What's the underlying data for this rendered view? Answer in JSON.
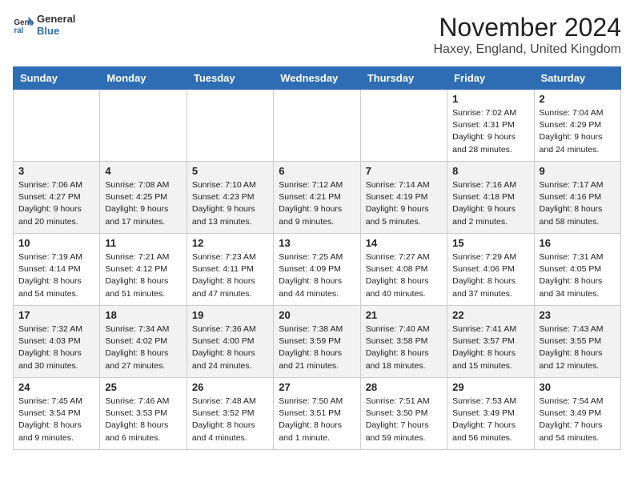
{
  "logo": {
    "general": "General",
    "blue": "Blue"
  },
  "title": "November 2024",
  "location": "Haxey, England, United Kingdom",
  "days_of_week": [
    "Sunday",
    "Monday",
    "Tuesday",
    "Wednesday",
    "Thursday",
    "Friday",
    "Saturday"
  ],
  "weeks": [
    [
      {
        "day": "",
        "info": ""
      },
      {
        "day": "",
        "info": ""
      },
      {
        "day": "",
        "info": ""
      },
      {
        "day": "",
        "info": ""
      },
      {
        "day": "",
        "info": ""
      },
      {
        "day": "1",
        "info": "Sunrise: 7:02 AM\nSunset: 4:31 PM\nDaylight: 9 hours and 28 minutes."
      },
      {
        "day": "2",
        "info": "Sunrise: 7:04 AM\nSunset: 4:29 PM\nDaylight: 9 hours and 24 minutes."
      }
    ],
    [
      {
        "day": "3",
        "info": "Sunrise: 7:06 AM\nSunset: 4:27 PM\nDaylight: 9 hours and 20 minutes."
      },
      {
        "day": "4",
        "info": "Sunrise: 7:08 AM\nSunset: 4:25 PM\nDaylight: 9 hours and 17 minutes."
      },
      {
        "day": "5",
        "info": "Sunrise: 7:10 AM\nSunset: 4:23 PM\nDaylight: 9 hours and 13 minutes."
      },
      {
        "day": "6",
        "info": "Sunrise: 7:12 AM\nSunset: 4:21 PM\nDaylight: 9 hours and 9 minutes."
      },
      {
        "day": "7",
        "info": "Sunrise: 7:14 AM\nSunset: 4:19 PM\nDaylight: 9 hours and 5 minutes."
      },
      {
        "day": "8",
        "info": "Sunrise: 7:16 AM\nSunset: 4:18 PM\nDaylight: 9 hours and 2 minutes."
      },
      {
        "day": "9",
        "info": "Sunrise: 7:17 AM\nSunset: 4:16 PM\nDaylight: 8 hours and 58 minutes."
      }
    ],
    [
      {
        "day": "10",
        "info": "Sunrise: 7:19 AM\nSunset: 4:14 PM\nDaylight: 8 hours and 54 minutes."
      },
      {
        "day": "11",
        "info": "Sunrise: 7:21 AM\nSunset: 4:12 PM\nDaylight: 8 hours and 51 minutes."
      },
      {
        "day": "12",
        "info": "Sunrise: 7:23 AM\nSunset: 4:11 PM\nDaylight: 8 hours and 47 minutes."
      },
      {
        "day": "13",
        "info": "Sunrise: 7:25 AM\nSunset: 4:09 PM\nDaylight: 8 hours and 44 minutes."
      },
      {
        "day": "14",
        "info": "Sunrise: 7:27 AM\nSunset: 4:08 PM\nDaylight: 8 hours and 40 minutes."
      },
      {
        "day": "15",
        "info": "Sunrise: 7:29 AM\nSunset: 4:06 PM\nDaylight: 8 hours and 37 minutes."
      },
      {
        "day": "16",
        "info": "Sunrise: 7:31 AM\nSunset: 4:05 PM\nDaylight: 8 hours and 34 minutes."
      }
    ],
    [
      {
        "day": "17",
        "info": "Sunrise: 7:32 AM\nSunset: 4:03 PM\nDaylight: 8 hours and 30 minutes."
      },
      {
        "day": "18",
        "info": "Sunrise: 7:34 AM\nSunset: 4:02 PM\nDaylight: 8 hours and 27 minutes."
      },
      {
        "day": "19",
        "info": "Sunrise: 7:36 AM\nSunset: 4:00 PM\nDaylight: 8 hours and 24 minutes."
      },
      {
        "day": "20",
        "info": "Sunrise: 7:38 AM\nSunset: 3:59 PM\nDaylight: 8 hours and 21 minutes."
      },
      {
        "day": "21",
        "info": "Sunrise: 7:40 AM\nSunset: 3:58 PM\nDaylight: 8 hours and 18 minutes."
      },
      {
        "day": "22",
        "info": "Sunrise: 7:41 AM\nSunset: 3:57 PM\nDaylight: 8 hours and 15 minutes."
      },
      {
        "day": "23",
        "info": "Sunrise: 7:43 AM\nSunset: 3:55 PM\nDaylight: 8 hours and 12 minutes."
      }
    ],
    [
      {
        "day": "24",
        "info": "Sunrise: 7:45 AM\nSunset: 3:54 PM\nDaylight: 8 hours and 9 minutes."
      },
      {
        "day": "25",
        "info": "Sunrise: 7:46 AM\nSunset: 3:53 PM\nDaylight: 8 hours and 6 minutes."
      },
      {
        "day": "26",
        "info": "Sunrise: 7:48 AM\nSunset: 3:52 PM\nDaylight: 8 hours and 4 minutes."
      },
      {
        "day": "27",
        "info": "Sunrise: 7:50 AM\nSunset: 3:51 PM\nDaylight: 8 hours and 1 minute."
      },
      {
        "day": "28",
        "info": "Sunrise: 7:51 AM\nSunset: 3:50 PM\nDaylight: 7 hours and 59 minutes."
      },
      {
        "day": "29",
        "info": "Sunrise: 7:53 AM\nSunset: 3:49 PM\nDaylight: 7 hours and 56 minutes."
      },
      {
        "day": "30",
        "info": "Sunrise: 7:54 AM\nSunset: 3:49 PM\nDaylight: 7 hours and 54 minutes."
      }
    ]
  ]
}
